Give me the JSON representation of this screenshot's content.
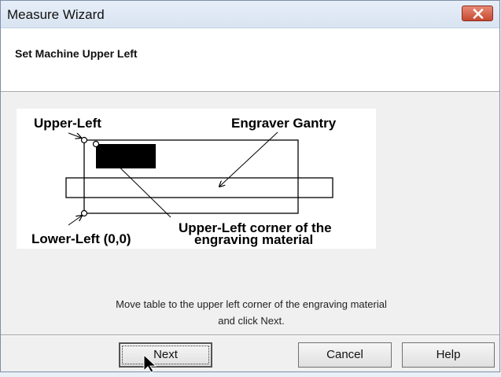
{
  "window": {
    "title": "Measure Wizard"
  },
  "header": {
    "heading": "Set Machine Upper Left"
  },
  "diagram": {
    "label_upper_left": "Upper-Left",
    "label_engraver_gantry": "Engraver Gantry",
    "label_lower_left": "Lower-Left (0,0)",
    "label_material_corner_line1": "Upper-Left corner of the",
    "label_material_corner_line2": "engraving material"
  },
  "instruction": {
    "line1": "Move table to the upper left corner of the engraving material",
    "line2": "and click Next."
  },
  "buttons": {
    "next": "Next",
    "cancel": "Cancel",
    "help": "Help"
  },
  "icons": {
    "close": "close-icon",
    "cursor": "mouse-pointer-icon"
  }
}
